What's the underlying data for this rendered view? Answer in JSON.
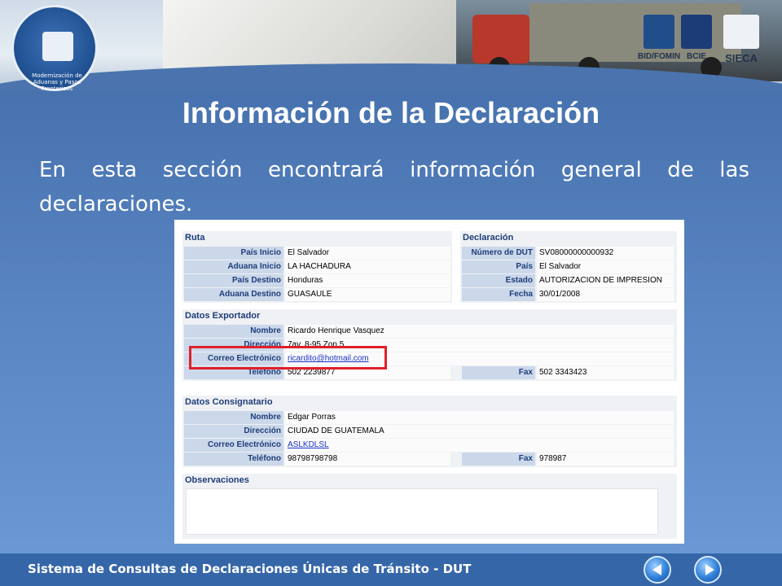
{
  "slide": {
    "title": "Información de la Declaración",
    "intro": "En esta sección encontrará información general de las declaraciones.",
    "footer": "Sistema de Consultas de Declaraciones Únicas de Tránsito - DUT"
  },
  "header": {
    "logo_text": "Modernización de Aduanas y Pasos Fronterizos",
    "partners": [
      "BID/FOMIN",
      "BCIE",
      "SIECA"
    ]
  },
  "ruta": {
    "title": "Ruta",
    "fields": [
      {
        "label": "País Inicio",
        "value": "El Salvador"
      },
      {
        "label": "Aduana Inicio",
        "value": "LA HACHADURA"
      },
      {
        "label": "País Destino",
        "value": "Honduras"
      },
      {
        "label": "Aduana Destino",
        "value": "GUASAULE"
      }
    ]
  },
  "declaracion": {
    "title": "Declaración",
    "fields": [
      {
        "label": "Número de DUT",
        "value": "SV08000000000932"
      },
      {
        "label": "País",
        "value": "El Salvador"
      },
      {
        "label": "Estado",
        "value": "AUTORIZACION DE IMPRESION"
      },
      {
        "label": "Fecha",
        "value": "30/01/2008"
      }
    ]
  },
  "exportador": {
    "title": "Datos Exportador",
    "nombre_label": "Nombre",
    "nombre": "Ricardo Henrique Vasquez",
    "direccion_label": "Dirección",
    "direccion": "7av. 8-95 Zon 5",
    "correo_label": "Correo Electrónico",
    "correo": "ricardito@hotmail.com",
    "telefono_label": "Teléfono",
    "telefono": "502 2239877",
    "fax_label": "Fax",
    "fax": "502 3343423"
  },
  "consignatario": {
    "title": "Datos Consignatario",
    "nombre_label": "Nombre",
    "nombre": "Edgar Porras",
    "direccion_label": "Dirección",
    "direccion": "CIUDAD DE GUATEMALA",
    "correo_label": "Correo Electrónico",
    "correo": "ASLKDLSL",
    "telefono_label": "Teléfono",
    "telefono": "98798798798",
    "fax_label": "Fax",
    "fax": "978987"
  },
  "observaciones": {
    "title": "Observaciones",
    "value": ""
  },
  "nav": {
    "prev_icon": "arrow-left-icon",
    "next_icon": "arrow-right-icon"
  },
  "colors": {
    "background": "#4f7bbb",
    "highlight": "#e0202a",
    "label_bg": "#cbd8ea",
    "label_text": "#1e3d7a"
  }
}
